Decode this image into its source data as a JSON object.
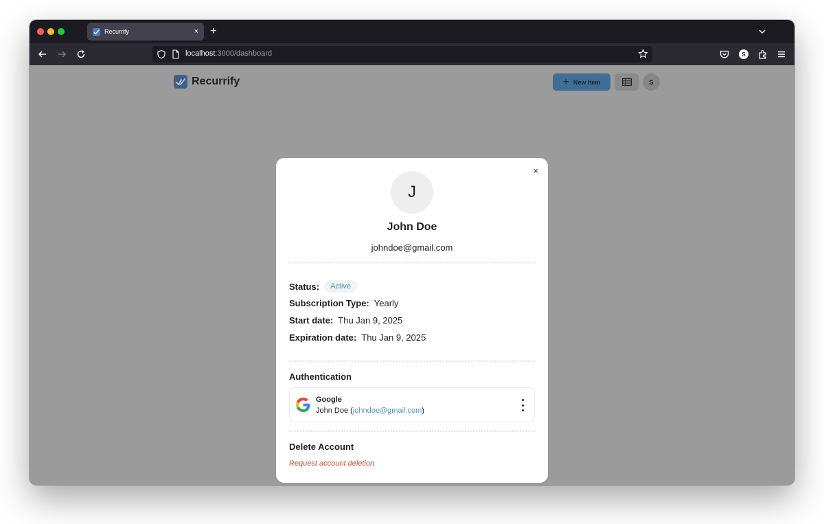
{
  "browser": {
    "tab_title": "Recurrify",
    "tab_close": "×",
    "new_tab": "+",
    "url_host": "localhost",
    "url_path": ":3000/dashboard",
    "profile_initial": "S"
  },
  "header": {
    "brand_name": "Recurrify",
    "new_item_label": "New Item",
    "user_initial": "S"
  },
  "profile": {
    "avatar_initial": "J",
    "name": "John Doe",
    "email": "johndoe@gmail.com",
    "close": "×"
  },
  "details": {
    "status_label": "Status:",
    "status_value": "Active",
    "subscription_label": "Subscription Type:",
    "subscription_value": "Yearly",
    "start_label": "Start date:",
    "start_value": "Thu Jan 9, 2025",
    "expiration_label": "Expiration date:",
    "expiration_value": "Thu Jan 9, 2025"
  },
  "authentication": {
    "title": "Authentication",
    "provider": "Google",
    "account_name": "John Doe",
    "account_open": " (",
    "account_email": "johndoe@gmail.com",
    "account_close": ")"
  },
  "delete_account": {
    "title": "Delete Account",
    "link": "Request account deletion"
  },
  "colors": {
    "accent": "#3f6d96",
    "status": "#5b8fb0",
    "danger": "#cf4a3b"
  }
}
